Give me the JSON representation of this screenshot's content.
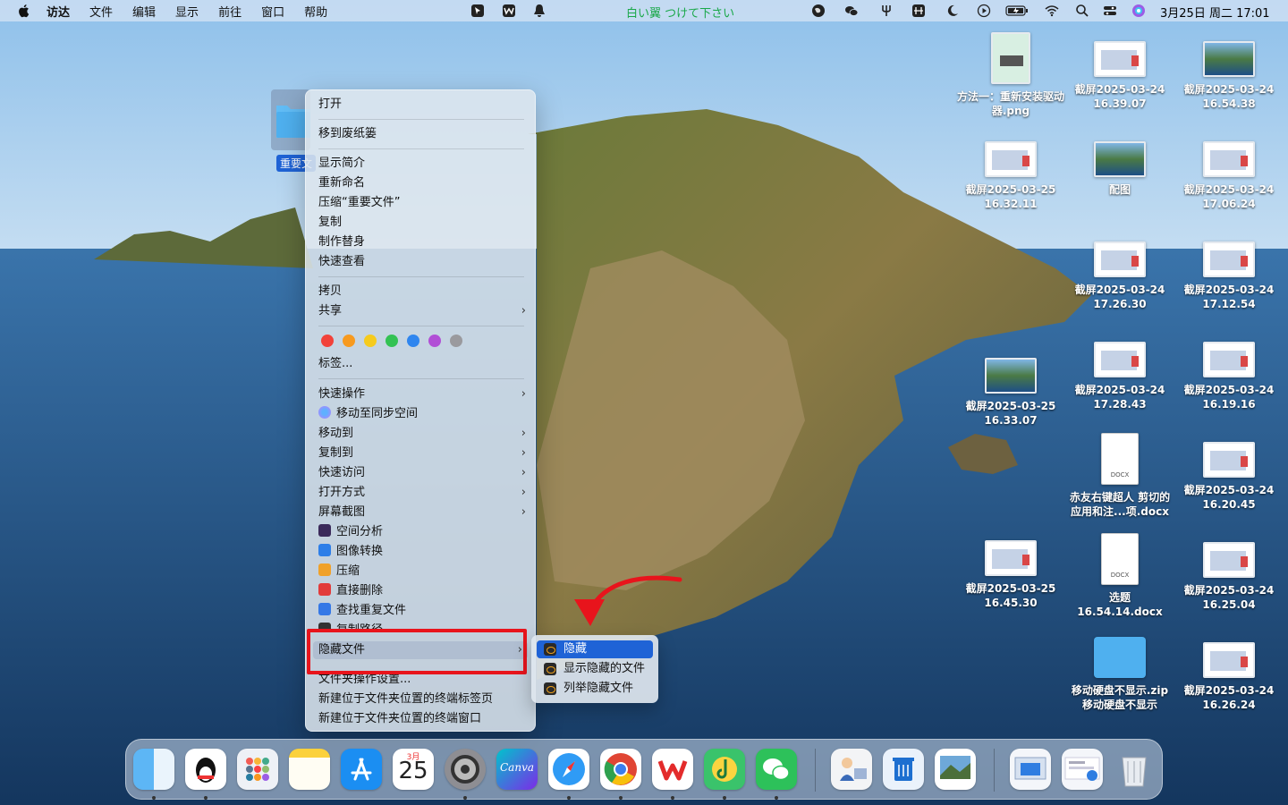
{
  "menubar": {
    "app_name": "访达",
    "items": [
      "文件",
      "编辑",
      "显示",
      "前往",
      "窗口",
      "帮助"
    ],
    "center_text": "白い翼 つけて下さい",
    "clock": "3月25日 周二  17:01"
  },
  "selected_item": {
    "label": "重要文"
  },
  "context_menu": {
    "open": "打开",
    "trash": "移到废纸篓",
    "get_info": "显示简介",
    "rename": "重新命名",
    "compress": "压缩“重要文件”",
    "duplicate": "复制",
    "make_alias": "制作替身",
    "quick_look": "快速查看",
    "copy": "拷贝",
    "share": "共享",
    "tags": "标签...",
    "tag_colors": [
      "#f2423a",
      "#f79a1f",
      "#f6cb1d",
      "#33c253",
      "#2f86ef",
      "#b14fd6",
      "#9a9a9e"
    ],
    "quick_actions": "快速操作",
    "move_to_sync": "移动至同步空间",
    "move_to": "移动到",
    "copy_to": "复制到",
    "quick_access": "快速访问",
    "open_with": "打开方式",
    "screenshot": "屏幕截图",
    "space_analysis": "空间分析",
    "image_convert": "图像转换",
    "compress2": "压缩",
    "delete_direct": "直接删除",
    "find_duplicates": "查找重复文件",
    "copy_path": "复制路径",
    "hide_file": "隐藏文件",
    "folder_settings": "文件夹操作设置...",
    "new_terminal_tab": "新建位于文件夹位置的终端标签页",
    "new_terminal_window": "新建位于文件夹位置的终端窗口",
    "chevron": "›"
  },
  "submenu": {
    "hide": "隐藏",
    "show_hidden": "显示隐藏的文件",
    "list_hidden": "列举隐藏文件"
  },
  "desktop": {
    "col1": [
      {
        "label": "方法一：重新安装驱动器.png",
        "kind": "poster"
      },
      {
        "label": "截屏2025-03-25 16.32.11",
        "kind": "shot"
      },
      {
        "label": "截屏2025-03-25 16.33.07",
        "kind": "photo"
      },
      {
        "label": "截屏2025-03-25 16.45.30",
        "kind": "shot"
      }
    ],
    "col2": [
      {
        "label": "截屏2025-03-24 16.39.07",
        "kind": "shot"
      },
      {
        "label": "配图",
        "kind": "photo"
      },
      {
        "label": "截屏2025-03-24 17.26.30",
        "kind": "shot"
      },
      {
        "label": "截屏2025-03-24 17.28.43",
        "kind": "shot"
      },
      {
        "label": "赤友右键超人 剪切的应用和注...项.docx",
        "kind": "doc"
      },
      {
        "label": "选题 16.54.14.docx",
        "kind": "doc"
      },
      {
        "label": "移动硬盘不显示.zip 移动硬盘不显示",
        "kind": "folder"
      }
    ],
    "col3": [
      {
        "label": "截屏2025-03-24 16.54.38",
        "kind": "photo"
      },
      {
        "label": "截屏2025-03-24 17.06.24",
        "kind": "shot"
      },
      {
        "label": "截屏2025-03-24 17.12.54",
        "kind": "shot"
      },
      {
        "label": "截屏2025-03-24 16.19.16",
        "kind": "shot"
      },
      {
        "label": "截屏2025-03-24 16.20.45",
        "kind": "shot"
      },
      {
        "label": "截屏2025-03-24 16.25.04",
        "kind": "shot"
      },
      {
        "label": "截屏2025-03-24 16.26.24",
        "kind": "shot"
      }
    ]
  },
  "dock": {
    "calendar_month": "3月",
    "calendar_day": "25",
    "canva_text": "Canva"
  }
}
